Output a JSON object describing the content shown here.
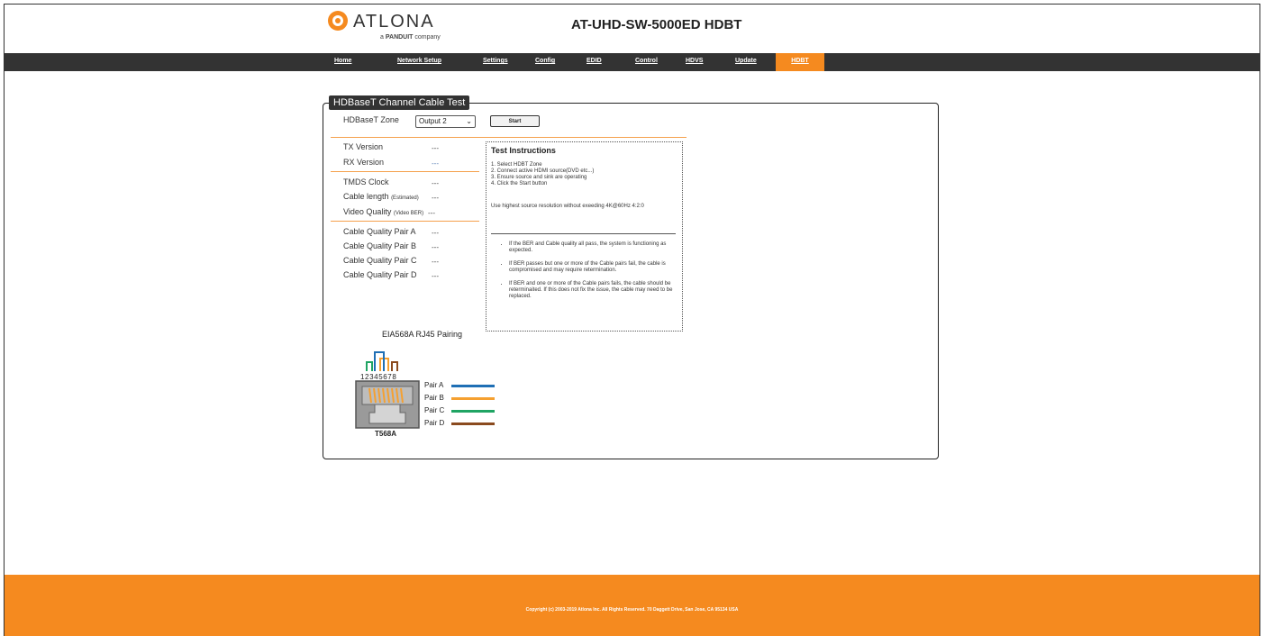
{
  "header": {
    "brand": "ATLONA",
    "brand_sub_prefix": "a",
    "brand_sub_company": "PANDUIT",
    "brand_sub_suffix": "company",
    "device_title": "AT-UHD-SW-5000ED HDBT"
  },
  "nav": {
    "items": [
      {
        "label": "Home"
      },
      {
        "label": "Network Setup"
      },
      {
        "label": "Settings"
      },
      {
        "label": "Config"
      },
      {
        "label": "EDID"
      },
      {
        "label": "Control"
      },
      {
        "label": "HDVS"
      },
      {
        "label": "Update"
      },
      {
        "label": "HDBT"
      }
    ],
    "active": "HDBT"
  },
  "panel": {
    "title": "HDBaseT Channel Cable Test",
    "zone_label": "HDBaseT Zone",
    "zone_value": "Output 2",
    "start_label": "Start"
  },
  "status": {
    "tx_version": {
      "label": "TX Version",
      "value": "---"
    },
    "rx_version": {
      "label": "RX Version",
      "value": "---"
    },
    "tmds_clock": {
      "label": "TMDS Clock",
      "value": "---"
    },
    "cable_length": {
      "label": "Cable length",
      "note": "(Estimated)",
      "value": "---"
    },
    "video_quality": {
      "label": "Video Quality",
      "note": "(Video BER)",
      "value": "---"
    },
    "pair_a": {
      "label": "Cable Quality Pair A",
      "value": "---"
    },
    "pair_b": {
      "label": "Cable Quality Pair B",
      "value": "---"
    },
    "pair_c": {
      "label": "Cable Quality Pair C",
      "value": "---"
    },
    "pair_d": {
      "label": "Cable Quality Pair D",
      "value": "---"
    }
  },
  "instructions": {
    "title": "Test Instructions",
    "steps": [
      "1. Select HDBT Zone",
      "2. Connect active HDMI source(DVD etc...)",
      "3. Ensure source and sink are operating",
      "4. Click the Start button"
    ],
    "note": "Use highest source resolution without exeeding 4K@60Hz 4:2:0",
    "bullets": [
      "If the BER and Cable quality all pass, the system is functioning as expected.",
      "If BER passes but one or more of the Cable pairs fail, the cable is compromised and may require retermination.",
      "If BER and one or more of the Cable pairs fails, the cable should be reterminaited. If this does not fix the issue, the cable may need to be replaced."
    ]
  },
  "diagram": {
    "title": "EIA568A RJ45 Pairing",
    "pin_numbers": "12345678",
    "connector_label": "T568A",
    "pairs": [
      {
        "label": "Pair A",
        "color": "#1f6fb5"
      },
      {
        "label": "Pair B",
        "color": "#f5a030"
      },
      {
        "label": "Pair C",
        "color": "#1fa463"
      },
      {
        "label": "Pair D",
        "color": "#8a4a1e"
      }
    ]
  },
  "footer": {
    "copyright": "Copyright (c) 2003-2019 Atlona Inc. All Rights Reserved. 70 Daggett Drive, San Jose, CA 95134 USA"
  },
  "colors": {
    "accent": "#f58a1f",
    "nav_bg": "#333333"
  }
}
